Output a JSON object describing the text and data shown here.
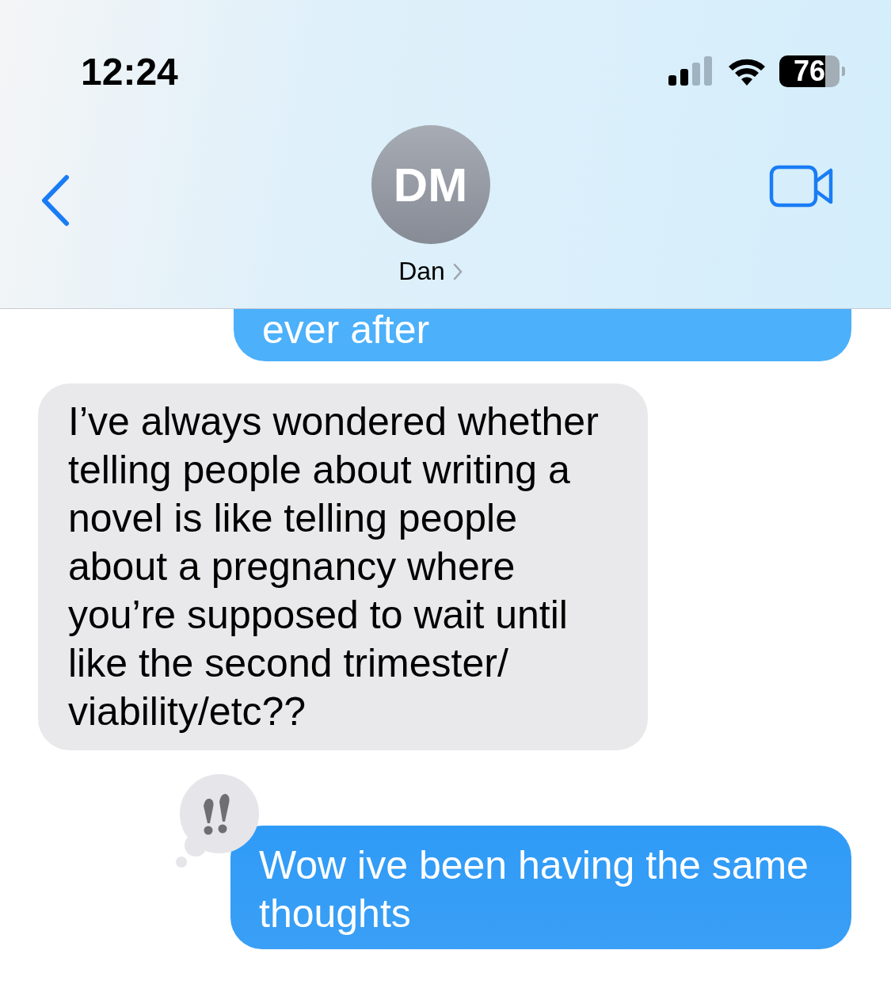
{
  "status_bar": {
    "time": "12:24",
    "battery": "76"
  },
  "header": {
    "avatar_initials": "DM",
    "contact_name": "Dan"
  },
  "messages": [
    {
      "kind": "sent",
      "text": "ever after",
      "emphasized": false
    },
    {
      "kind": "received",
      "text": "I’ve always wondered whether telling people about writing a novel is like telling people about a pregnancy where you’re supposed to wait until like the second trimester/ viability/etc??",
      "emphasized": false
    },
    {
      "kind": "sent",
      "text": "Wow ive been having the same thoughts",
      "emphasized": true
    }
  ]
}
